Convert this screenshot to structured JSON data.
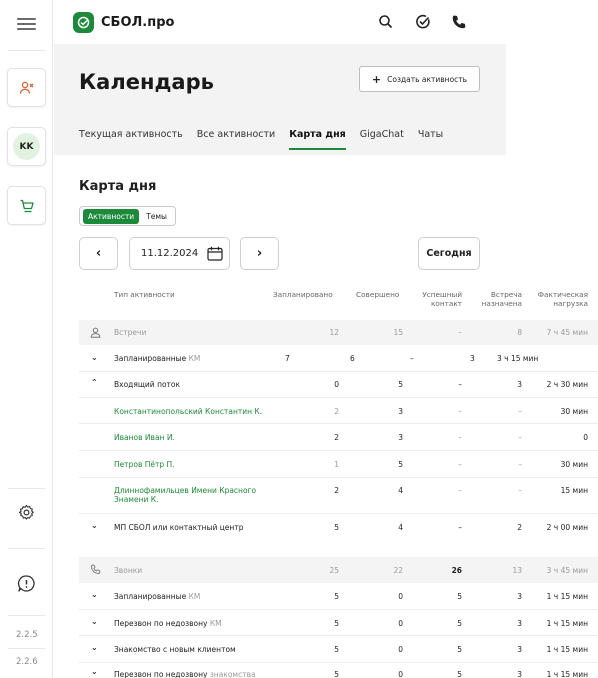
{
  "app": {
    "brand": "СБОЛ.про"
  },
  "rail": {
    "version_1": "2.2.5",
    "version_2": "2.2.6",
    "avatar_initials": "KK"
  },
  "header": {
    "title": "Календарь",
    "create_button": "Создать активность"
  },
  "tabs": [
    {
      "label": "Текущая активность",
      "active": false
    },
    {
      "label": "Все активности",
      "active": false
    },
    {
      "label": "Карта дня",
      "active": true
    },
    {
      "label": "GigaChat",
      "active": false
    },
    {
      "label": "Чаты",
      "active": false
    }
  ],
  "daymap": {
    "title": "Карта дня",
    "toggle": {
      "left": "Активности",
      "right": "Темы"
    },
    "date": "11.12.2024",
    "today": "Сегодня"
  },
  "columns": {
    "type": "Тип активности",
    "planned": "Запланировано",
    "done": "Совершено",
    "success_1": "Успешный",
    "success_2": "контакт",
    "meeting_1": "Встреча",
    "meeting_2": "назначена",
    "load_1": "Фактическая",
    "load_2": "нагрузка"
  },
  "rows": {
    "meet": {
      "name": "Встречи",
      "planned": "12",
      "done": "15",
      "success": "–",
      "meeting": "8",
      "load": "7 ч 45 мин"
    },
    "m_planned": {
      "name": "Запланированные",
      "tag": "КМ",
      "planned": "7",
      "done": "6",
      "success": "–",
      "meeting": "3",
      "load": "3 ч 15 мин"
    },
    "m_incoming": {
      "name": "Входящий поток",
      "planned": "0",
      "done": "5",
      "success": "–",
      "meeting": "3",
      "load": "2 ч 30 мин"
    },
    "p1": {
      "name": "Константинопольский Константин К.",
      "planned": "2",
      "done": "3",
      "success": "–",
      "meeting": "–",
      "load": "30 мин"
    },
    "p2": {
      "name": "Иванов Иван И.",
      "planned": "2",
      "done": "3",
      "success": "–",
      "meeting": "–",
      "load": "0"
    },
    "p3": {
      "name": "Петров Пётр П.",
      "planned": "1",
      "done": "5",
      "success": "–",
      "meeting": "–",
      "load": "30 мин"
    },
    "p4": {
      "name_1": "Длиннофамильцев Имени Красного",
      "name_2": "Знамени К.",
      "planned": "2",
      "done": "4",
      "success": "–",
      "meeting": "–",
      "load": "15 мин"
    },
    "m_mp": {
      "name": "МП СБОЛ или контактный центр",
      "planned": "5",
      "done": "4",
      "success": "–",
      "meeting": "2",
      "load": "2 ч 00 мин"
    },
    "calls": {
      "name": "Звонки",
      "planned": "25",
      "done": "22",
      "success": "26",
      "meeting": "13",
      "load": "3 ч 45 мин"
    },
    "c_planned": {
      "name": "Запланированные",
      "tag": "КМ",
      "planned": "5",
      "done": "0",
      "success": "5",
      "meeting": "3",
      "load": "1 ч 15 мин"
    },
    "c_redial": {
      "name": "Перезвон по недозвону",
      "tag": "КМ",
      "planned": "5",
      "done": "0",
      "success": "5",
      "meeting": "3",
      "load": "1 ч 15 мин"
    },
    "c_new": {
      "name": "Знакомство с новым клиентом",
      "planned": "5",
      "done": "0",
      "success": "5",
      "meeting": "3",
      "load": "1 ч 15 мин"
    },
    "c_redial2": {
      "name": "Перезвон по недозвону",
      "tag": "знакомства",
      "planned": "5",
      "done": "0",
      "success": "5",
      "meeting": "3",
      "load": "1 ч 15 мин"
    }
  },
  "colors": {
    "accent": "#1d8a3b",
    "group_bg": "#f4f4f4",
    "header_bg": "#f3f3f3"
  },
  "icons": [
    "menu-icon",
    "person-x-icon",
    "cart-icon",
    "settings-icon",
    "alert-icon",
    "search-icon",
    "check-circle-icon",
    "phone-icon",
    "plus-icon",
    "calendar-icon",
    "chevron-left-icon",
    "chevron-right-icon",
    "person-icon",
    "handset-icon",
    "chevron-down-icon",
    "chevron-up-icon"
  ]
}
